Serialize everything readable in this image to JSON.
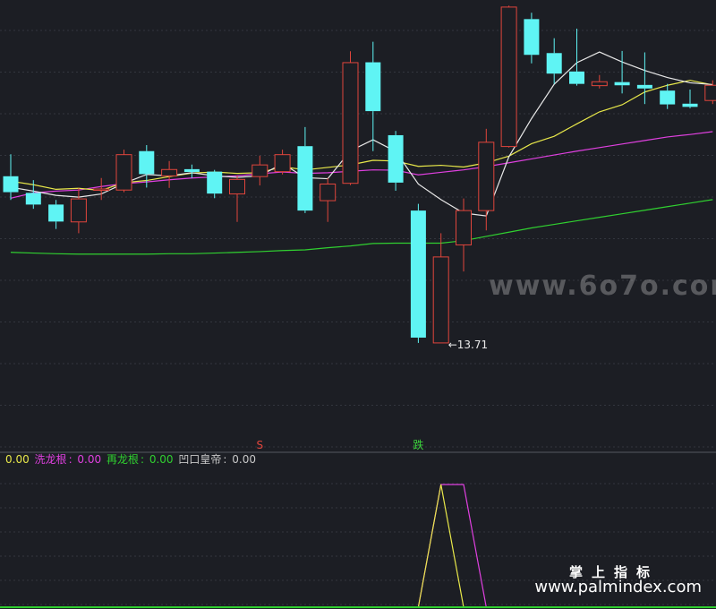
{
  "colors": {
    "background": "#1c1e24",
    "grid": "#33363e",
    "up_candle": "#e0453c",
    "down_candle": "#5ff4f4",
    "ma_white": "#e8e8e8",
    "ma_yellow": "#e8e84a",
    "ma_magenta": "#e040e0",
    "ma_green": "#30d030",
    "indicator_yellow": "#e8e84a",
    "indicator_magenta": "#e040e0",
    "indicator_green": "#30d030",
    "indicator_gray": "#c8c8c8",
    "signal_s": "#e0453c",
    "signal_die": "#3cd83c"
  },
  "chart_data": {
    "type": "candlestick",
    "price_range": [
      11.0,
      23.4
    ],
    "candles": [
      {
        "o": 18.42,
        "h": 19.04,
        "l": 17.75,
        "c": 17.97
      },
      {
        "o": 17.95,
        "h": 18.31,
        "l": 17.5,
        "c": 17.62
      },
      {
        "o": 17.62,
        "h": 17.75,
        "l": 16.93,
        "c": 17.14
      },
      {
        "o": 17.13,
        "h": 18.09,
        "l": 16.81,
        "c": 17.78
      },
      {
        "o": 18.05,
        "h": 18.37,
        "l": 17.75,
        "c": 18.06
      },
      {
        "o": 18.03,
        "h": 19.17,
        "l": 17.97,
        "c": 19.03
      },
      {
        "o": 19.13,
        "h": 19.3,
        "l": 18.1,
        "c": 18.48
      },
      {
        "o": 18.43,
        "h": 18.85,
        "l": 18.09,
        "c": 18.61
      },
      {
        "o": 18.62,
        "h": 18.75,
        "l": 18.37,
        "c": 18.54
      },
      {
        "o": 18.55,
        "h": 18.6,
        "l": 17.8,
        "c": 17.93
      },
      {
        "o": 17.92,
        "h": 18.43,
        "l": 17.13,
        "c": 18.33
      },
      {
        "o": 18.41,
        "h": 19.0,
        "l": 18.16,
        "c": 18.74
      },
      {
        "o": 18.55,
        "h": 19.17,
        "l": 18.47,
        "c": 19.03
      },
      {
        "o": 19.27,
        "h": 19.81,
        "l": 17.38,
        "c": 17.45
      },
      {
        "o": 17.73,
        "h": 18.37,
        "l": 17.13,
        "c": 18.2
      },
      {
        "o": 18.22,
        "h": 21.95,
        "l": 18.17,
        "c": 21.63
      },
      {
        "o": 21.64,
        "h": 22.22,
        "l": 19.13,
        "c": 20.26
      },
      {
        "o": 19.58,
        "h": 19.7,
        "l": 18.01,
        "c": 18.24
      },
      {
        "o": 17.45,
        "h": 17.64,
        "l": 13.71,
        "c": 13.86
      },
      {
        "o": 13.71,
        "h": 16.81,
        "l": 13.71,
        "c": 16.14
      },
      {
        "o": 16.48,
        "h": 17.79,
        "l": 15.73,
        "c": 17.45
      },
      {
        "o": 17.45,
        "h": 19.76,
        "l": 16.89,
        "c": 19.38
      },
      {
        "o": 19.26,
        "h": 23.24,
        "l": 19.23,
        "c": 23.2
      },
      {
        "o": 22.86,
        "h": 23.04,
        "l": 21.61,
        "c": 21.85
      },
      {
        "o": 21.9,
        "h": 22.32,
        "l": 21.03,
        "c": 21.32
      },
      {
        "o": 21.38,
        "h": 22.59,
        "l": 20.98,
        "c": 21.03
      },
      {
        "o": 20.98,
        "h": 21.28,
        "l": 20.9,
        "c": 21.09
      },
      {
        "o": 21.08,
        "h": 21.96,
        "l": 20.76,
        "c": 20.99
      },
      {
        "o": 21.0,
        "h": 21.92,
        "l": 20.46,
        "c": 20.9
      },
      {
        "o": 20.84,
        "h": 21.03,
        "l": 20.32,
        "c": 20.45
      },
      {
        "o": 20.47,
        "h": 20.87,
        "l": 20.34,
        "c": 20.38
      },
      {
        "o": 20.56,
        "h": 21.13,
        "l": 20.46,
        "c": 20.99
      }
    ],
    "ma_white": [
      18.11,
      18.0,
      17.88,
      17.83,
      17.92,
      18.22,
      18.47,
      18.43,
      18.52,
      18.43,
      18.39,
      18.43,
      18.78,
      18.38,
      18.35,
      19.14,
      19.45,
      19.12,
      18.2,
      17.76,
      17.38,
      17.3,
      18.97,
      20.05,
      21.02,
      21.63,
      21.93,
      21.65,
      21.41,
      21.21,
      21.06,
      21.01
    ],
    "ma_yellow": [
      18.28,
      18.18,
      18.05,
      18.08,
      18.02,
      18.24,
      18.3,
      18.41,
      18.51,
      18.54,
      18.5,
      18.52,
      18.69,
      18.6,
      18.67,
      18.74,
      18.87,
      18.85,
      18.7,
      18.73,
      18.68,
      18.8,
      18.99,
      19.34,
      19.55,
      19.9,
      20.24,
      20.44,
      20.8,
      20.99,
      21.13,
      21.0
    ],
    "ma_magenta": [
      17.8,
      17.95,
      18.0,
      18.03,
      18.13,
      18.21,
      18.26,
      18.32,
      18.37,
      18.4,
      18.43,
      18.49,
      18.54,
      18.5,
      18.52,
      18.56,
      18.6,
      18.59,
      18.46,
      18.53,
      18.6,
      18.69,
      18.8,
      18.91,
      19.02,
      19.13,
      19.23,
      19.33,
      19.43,
      19.53,
      19.6,
      19.68
    ],
    "ma_green": [
      16.27,
      16.25,
      16.23,
      16.22,
      16.22,
      16.22,
      16.22,
      16.23,
      16.23,
      16.25,
      16.27,
      16.29,
      16.32,
      16.34,
      16.4,
      16.45,
      16.52,
      16.53,
      16.53,
      16.53,
      16.6,
      16.72,
      16.84,
      16.96,
      17.06,
      17.16,
      17.26,
      17.36,
      17.46,
      17.56,
      17.66,
      17.76
    ],
    "low_annotation": {
      "index": 19,
      "label": "←13.71"
    },
    "signals": [
      {
        "index": 11,
        "label": "S"
      },
      {
        "index": 18,
        "label": "跌"
      }
    ],
    "indicator": {
      "title_partial": "0.00",
      "series": [
        {
          "name": "洗龙根",
          "value": "0.00"
        },
        {
          "name": "再龙根",
          "value": "0.00"
        },
        {
          "name": "凹口皇帝",
          "value": "0.00"
        }
      ],
      "yellow_line": [
        0,
        0,
        0,
        0,
        0,
        0,
        0,
        0,
        0,
        0,
        0,
        0,
        0,
        0,
        0,
        0,
        0,
        0,
        0,
        1,
        0,
        0,
        0,
        0,
        0,
        0,
        0,
        0,
        0,
        0,
        0,
        0
      ],
      "magenta_line": [
        0,
        0,
        0,
        0,
        0,
        0,
        0,
        0,
        0,
        0,
        0,
        0,
        0,
        0,
        0,
        0,
        0,
        0,
        0,
        1,
        1,
        0,
        0,
        0,
        0,
        0,
        0,
        0,
        0,
        0,
        0,
        0
      ]
    }
  },
  "watermarks": {
    "brand": "掌上指标",
    "url": "www.palmindex.com",
    "site": "www.6o7o.com"
  }
}
